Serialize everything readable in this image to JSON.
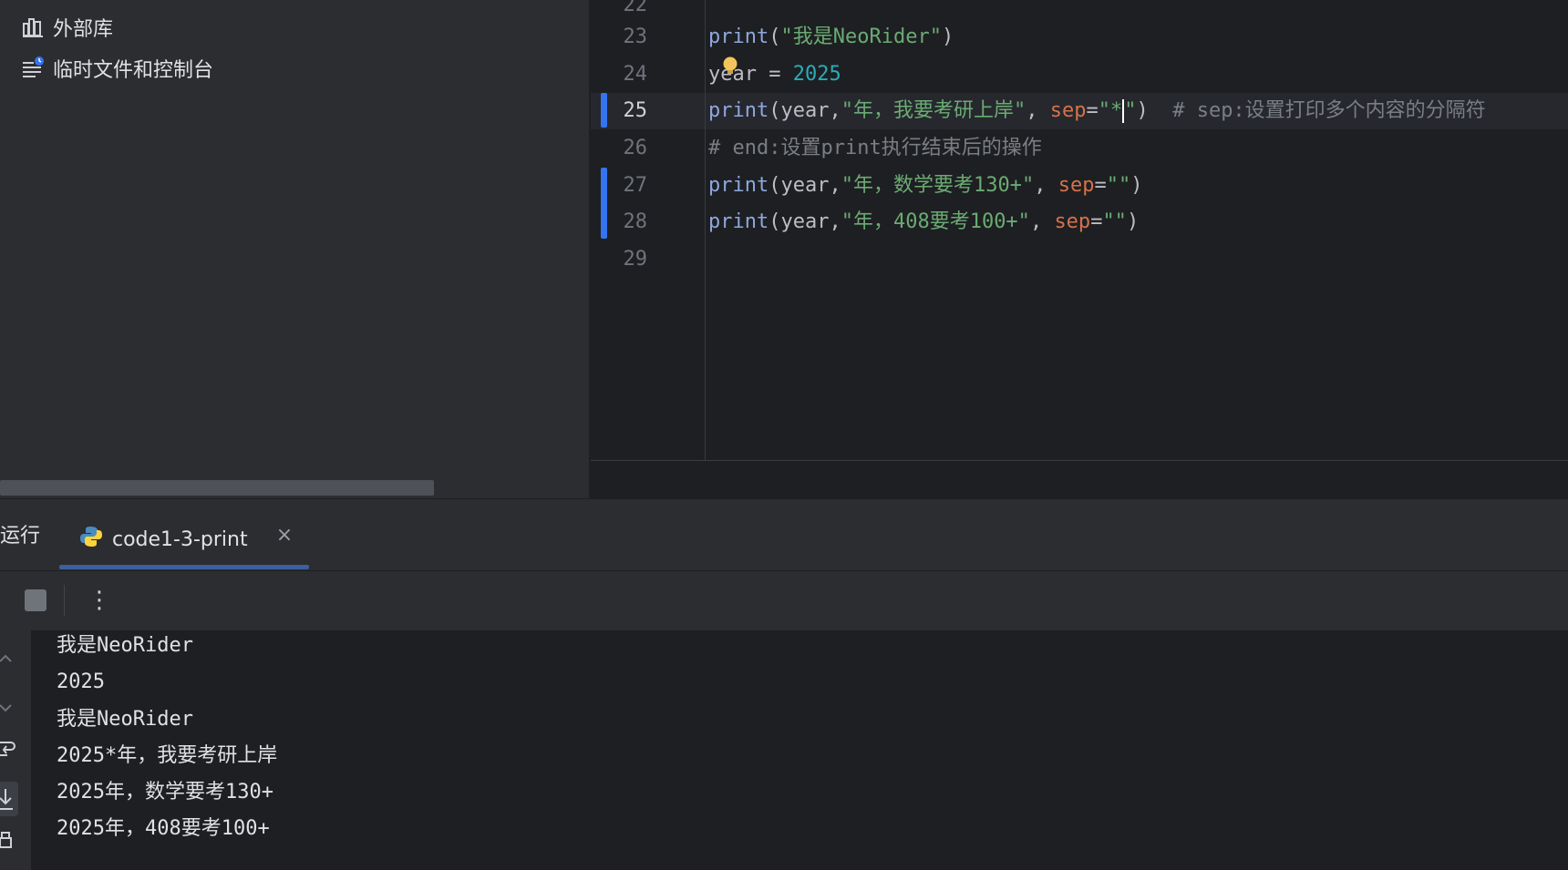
{
  "project_tree": {
    "items": [
      {
        "label": "外部库",
        "icon": "library-icon"
      },
      {
        "label": "临时文件和控制台",
        "icon": "scratches-icon"
      }
    ]
  },
  "editor": {
    "partial_line_number": "22",
    "active_line": "25",
    "lines": [
      {
        "num": "23"
      },
      {
        "num": "24"
      },
      {
        "num": "25"
      },
      {
        "num": "26"
      },
      {
        "num": "27"
      },
      {
        "num": "28"
      },
      {
        "num": "29"
      }
    ],
    "code": {
      "l23": {
        "fn": "print",
        "open": "(",
        "str": "\"我是NeoRider\"",
        "close": ")"
      },
      "l24": {
        "var": "year",
        "op": " = ",
        "num": "2025"
      },
      "l25": {
        "fn": "print",
        "open": "(",
        "var": "year",
        "comma": ",",
        "str": "\"年，我要考研上岸\"",
        "sep_comma": ", ",
        "param": "sep",
        "eq": "=",
        "str2_open": "\"*",
        "str2_close": "\"",
        "close": ")",
        "comment": "  # sep:设置打印多个内容的分隔符"
      },
      "l26": {
        "comment": "# end:设置print执行结束后的操作"
      },
      "l27": {
        "fn": "print",
        "open": "(",
        "var": "year",
        "comma": ",",
        "str": "\"年，数学要考130+\"",
        "sep_comma": ", ",
        "param": "sep",
        "eq": "=",
        "str2": "\"\"",
        "close": ")"
      },
      "l28": {
        "fn": "print",
        "open": "(",
        "var": "year",
        "comma": ",",
        "str": "\"年，408要考100+\"",
        "sep_comma": ", ",
        "param": "sep",
        "eq": "=",
        "str2": "\"\"",
        "close": ")"
      }
    }
  },
  "run": {
    "title": "运行",
    "tab_label": "code1-3-print",
    "output": [
      "我是NeoRider",
      "2025",
      "我是NeoRider",
      "2025*年，我要考研上岸",
      "2025年，数学要考130+",
      "2025年，408要考100+"
    ]
  },
  "colors": {
    "accent": "#3574f0",
    "string": "#6aab73",
    "number": "#2aacb8",
    "param": "#d5724b",
    "comment": "#7a7e85"
  }
}
